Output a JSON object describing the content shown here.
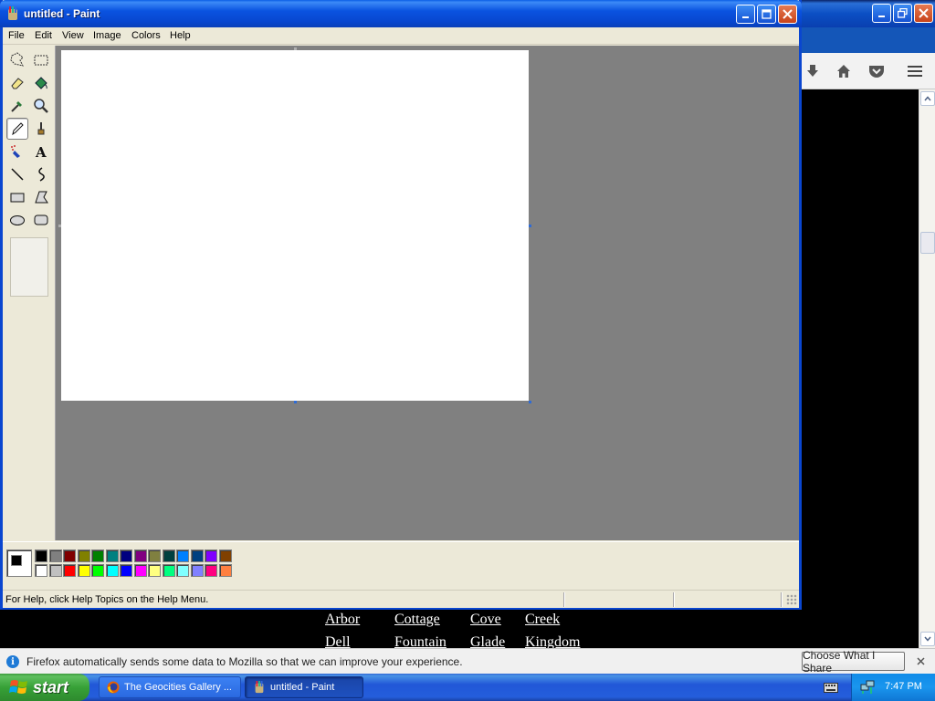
{
  "firefox": {
    "geo_links": [
      "Arbor",
      "Cottage",
      "Cove",
      "Creek",
      "Dell",
      "Fountain",
      "Glade",
      "Kingdom"
    ],
    "notification": {
      "text": "Firefox automatically sends some data to Mozilla so that we can improve your experience.",
      "button": "Choose What I Share"
    }
  },
  "paint": {
    "title": "untitled - Paint",
    "menus": [
      "File",
      "Edit",
      "View",
      "Image",
      "Colors",
      "Help"
    ],
    "status_text": "For Help, click Help Topics on the Help Menu.",
    "palette_top": [
      "#000000",
      "#808080",
      "#800000",
      "#808000",
      "#008000",
      "#008080",
      "#000080",
      "#800080",
      "#808040",
      "#004040",
      "#0080ff",
      "#004080",
      "#8000ff",
      "#804000"
    ],
    "palette_bottom": [
      "#ffffff",
      "#c0c0c0",
      "#ff0000",
      "#ffff00",
      "#00ff00",
      "#00ffff",
      "#0000ff",
      "#ff00ff",
      "#ffff80",
      "#00ff80",
      "#80ffff",
      "#8080ff",
      "#ff0080",
      "#ff8040"
    ],
    "foreground_color": "#000000",
    "background_color": "#ffffff"
  },
  "taskbar": {
    "start_label": "start",
    "tasks": [
      "The Geocities Gallery ...",
      "untitled - Paint"
    ],
    "clock": "7:47 PM"
  }
}
